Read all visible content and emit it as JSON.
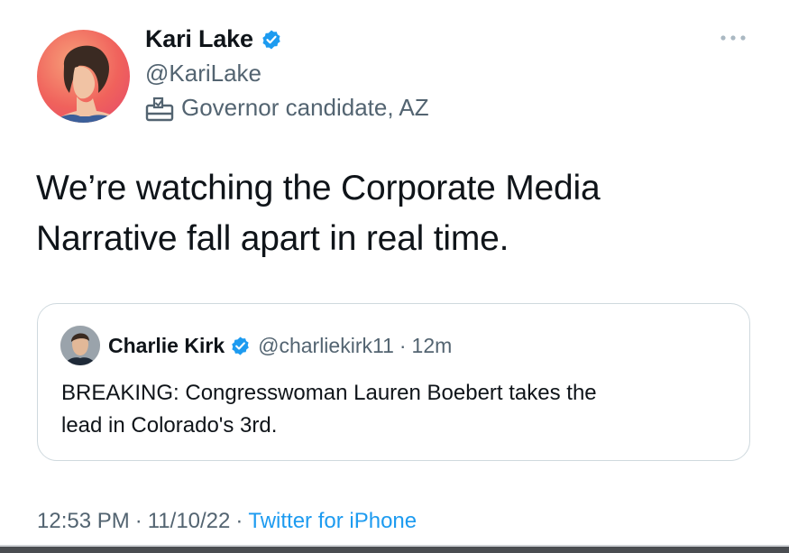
{
  "author": {
    "display_name": "Kari Lake",
    "handle": "@KariLake",
    "label": "Governor candidate, AZ",
    "verified": true
  },
  "tweet": {
    "text": "We’re watching the Corporate Media\nNarrative fall apart in real time."
  },
  "quoted_tweet": {
    "display_name": "Charlie Kirk",
    "handle": "@charliekirk11",
    "separator": "·",
    "time_ago": "12m",
    "verified": true,
    "text": "BREAKING: Congresswoman Lauren Boebert takes the\nlead in Colorado's 3rd."
  },
  "footer": {
    "time": "12:53 PM",
    "separator": "·",
    "date": "11/10/22",
    "source": "Twitter for iPhone"
  },
  "colors": {
    "verified_blue": "#1d9bf0",
    "secondary_text": "#536471",
    "primary_text": "#0f1419",
    "link": "#1d9bf0"
  },
  "icons": [
    "verified-badge-icon",
    "ballot-box-icon",
    "more-options-icon"
  ]
}
